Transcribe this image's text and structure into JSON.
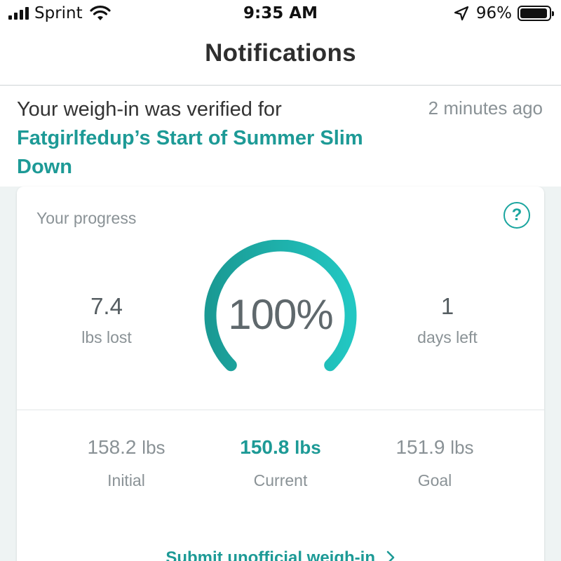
{
  "status_bar": {
    "carrier": "Sprint",
    "time": "9:35 AM",
    "battery_percent": "96%",
    "battery_level": 0.96,
    "icons": [
      "signal-bars-icon",
      "wifi-icon",
      "location-arrow-icon",
      "battery-icon"
    ]
  },
  "nav": {
    "title": "Notifications"
  },
  "notification": {
    "text": "Your weigh-in was verified for",
    "link": "Fatgirlfedup’s Start of Summer Slim Down",
    "time": "2 minutes ago"
  },
  "progress": {
    "label": "Your progress",
    "help_icon": "question-circle-icon",
    "help_glyph": "?",
    "lost": {
      "value": "7.4",
      "label": "lbs lost"
    },
    "percent": "100%",
    "percent_value": 1.0,
    "days": {
      "value": "1",
      "label": "days left"
    },
    "initial": {
      "value": "158.2",
      "unit": "lbs",
      "label": "Initial"
    },
    "current": {
      "value": "150.8",
      "unit": "lbs",
      "label": "Current"
    },
    "goal": {
      "value": "151.9",
      "unit": "lbs",
      "label": "Goal"
    },
    "submit": "Submit unofficial weigh-in",
    "submit_icon": "chevron-right-icon",
    "colors": {
      "accent": "#1d9a96",
      "gauge_start": "#1a9a94",
      "gauge_end": "#22c7c2"
    }
  }
}
